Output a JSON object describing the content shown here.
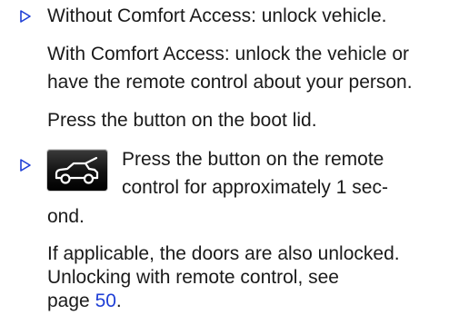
{
  "items": [
    {
      "bullet_icon": "triangle-right-outline-icon",
      "line1": "Without Comfort Access: unlock vehicle.",
      "para1_line1": "With Comfort Access: unlock the vehicle or",
      "para1_line2": "have the remote control about your person.",
      "para2": "Press the button on the boot lid."
    },
    {
      "bullet_icon": "triangle-right-outline-icon",
      "button_icon": "car-boot-open-icon",
      "line1": "Press the button on the remote",
      "line2": "control for approximately 1 sec-",
      "line3": "ond.",
      "para1_line1": "If applicable, the doors are also unlocked.",
      "para1_line2": "Unlocking with remote control, see",
      "para1_line3_prefix": "page ",
      "page_link": "50",
      "para1_line3_suffix": "."
    }
  ],
  "colors": {
    "text": "#1a1a1a",
    "link": "#1f3fd6",
    "bullet": "#1f3fd6"
  }
}
